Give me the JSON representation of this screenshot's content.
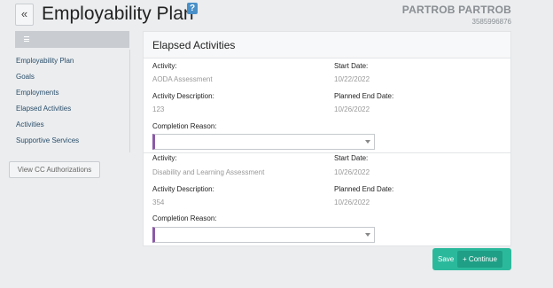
{
  "header": {
    "back_label": "«",
    "title": "Employability Plan",
    "help_label": "?",
    "user_name": "PARTROB PARTROB",
    "user_id": "3585996876"
  },
  "sidebar": {
    "items": [
      {
        "label": "Employability Plan"
      },
      {
        "label": "Goals"
      },
      {
        "label": "Employments"
      },
      {
        "label": "Elapsed Activities"
      },
      {
        "label": "Activities"
      },
      {
        "label": "Supportive Services"
      }
    ],
    "cc_button_label": "View CC Authorizations"
  },
  "panel": {
    "title": "Elapsed Activities",
    "labels": {
      "activity": "Activity:",
      "start_date": "Start Date:",
      "description": "Activity Description:",
      "planned_end": "Planned End Date:",
      "completion_reason": "Completion Reason:"
    },
    "activities": [
      {
        "activity": "AODA Assessment",
        "start_date": "10/22/2022",
        "description": "123",
        "planned_end": "10/26/2022",
        "completion_reason": ""
      },
      {
        "activity": "Disability and Learning Assessment",
        "start_date": "10/26/2022",
        "description": "354",
        "planned_end": "10/26/2022",
        "completion_reason": ""
      }
    ]
  },
  "footer": {
    "save_label": "Save",
    "continue_label": "+ Continue"
  },
  "colors": {
    "accent": "#2bb99c",
    "select_marker": "#8b5aa6",
    "help_icon": "#4a90c8",
    "nav_link": "#2b4f6b"
  }
}
